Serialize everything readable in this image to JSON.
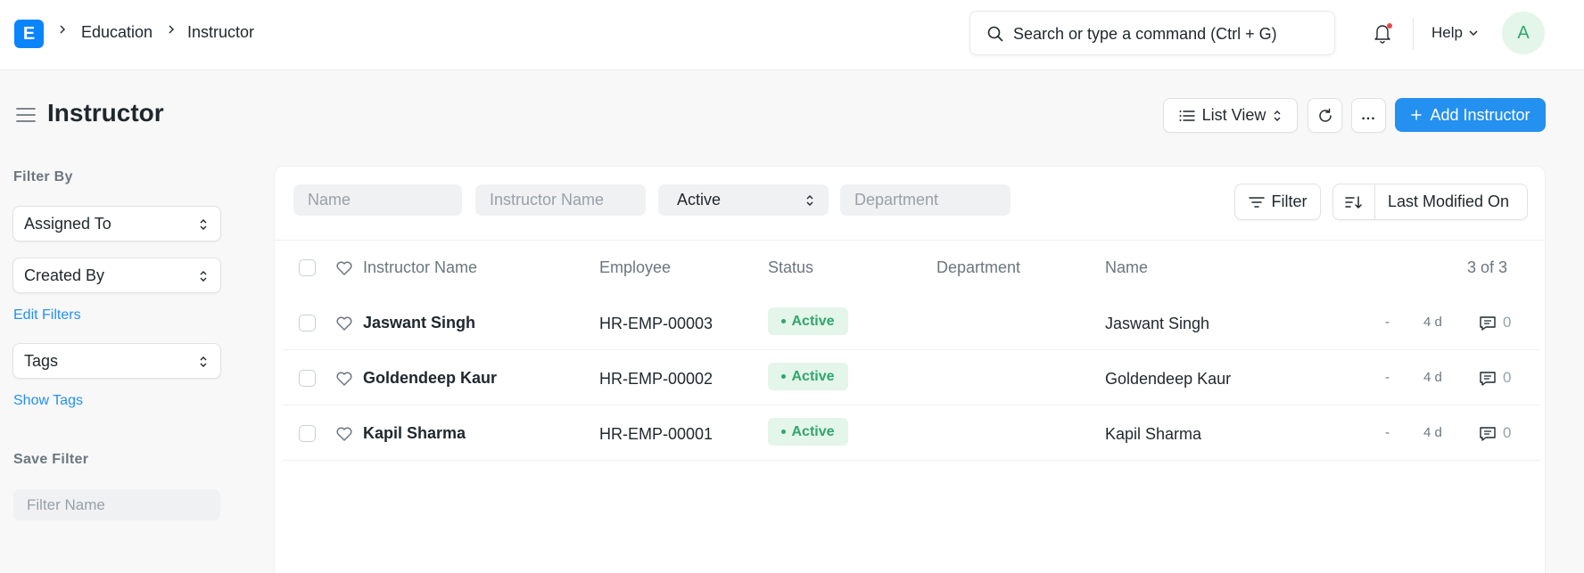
{
  "navbar": {
    "logo_letter": "E",
    "breadcrumbs": [
      "Education",
      "Instructor"
    ],
    "search_placeholder": "Search or type a command (Ctrl + G)",
    "help_label": "Help",
    "avatar_initial": "A"
  },
  "page": {
    "title": "Instructor",
    "view_label": "List View",
    "more_label": "...",
    "add_label": "Add Instructor"
  },
  "sidebar": {
    "filter_by_heading": "Filter By",
    "assigned_to": "Assigned To",
    "created_by": "Created By",
    "edit_filters": "Edit Filters",
    "tags": "Tags",
    "show_tags": "Show Tags",
    "save_filter_heading": "Save Filter",
    "filter_name_placeholder": "Filter Name"
  },
  "filters": {
    "name_placeholder": "Name",
    "instructor_name_placeholder": "Instructor Name",
    "status_value": "Active",
    "department_placeholder": "Department",
    "filter_button": "Filter",
    "sort_label": "Last Modified On"
  },
  "table": {
    "columns": [
      "Instructor Name",
      "Employee",
      "Status",
      "Department",
      "Name"
    ],
    "count_label": "3 of 3",
    "rows": [
      {
        "instructor_name": "Jaswant Singh",
        "employee": "HR-EMP-00003",
        "status": "Active",
        "department": "",
        "name": "Jaswant Singh",
        "dash": "-",
        "modified": "4 d",
        "comments": "0"
      },
      {
        "instructor_name": "Goldendeep Kaur",
        "employee": "HR-EMP-00002",
        "status": "Active",
        "department": "",
        "name": "Goldendeep Kaur",
        "dash": "-",
        "modified": "4 d",
        "comments": "0"
      },
      {
        "instructor_name": "Kapil Sharma",
        "employee": "HR-EMP-00001",
        "status": "Active",
        "department": "",
        "name": "Kapil Sharma",
        "dash": "-",
        "modified": "4 d",
        "comments": "0"
      }
    ]
  },
  "colors": {
    "primary": "#2490ef",
    "logo": "#0a84ff",
    "active_badge_bg": "#e4f5e9",
    "active_badge_text": "#30a66d"
  },
  "icons": [
    "search-icon",
    "bell-icon",
    "chevron-down-icon",
    "hamburger-icon",
    "list-icon",
    "refresh-icon",
    "plus-icon",
    "filter-icon",
    "sort-icon",
    "heart-icon",
    "comment-icon",
    "updown-icon"
  ]
}
